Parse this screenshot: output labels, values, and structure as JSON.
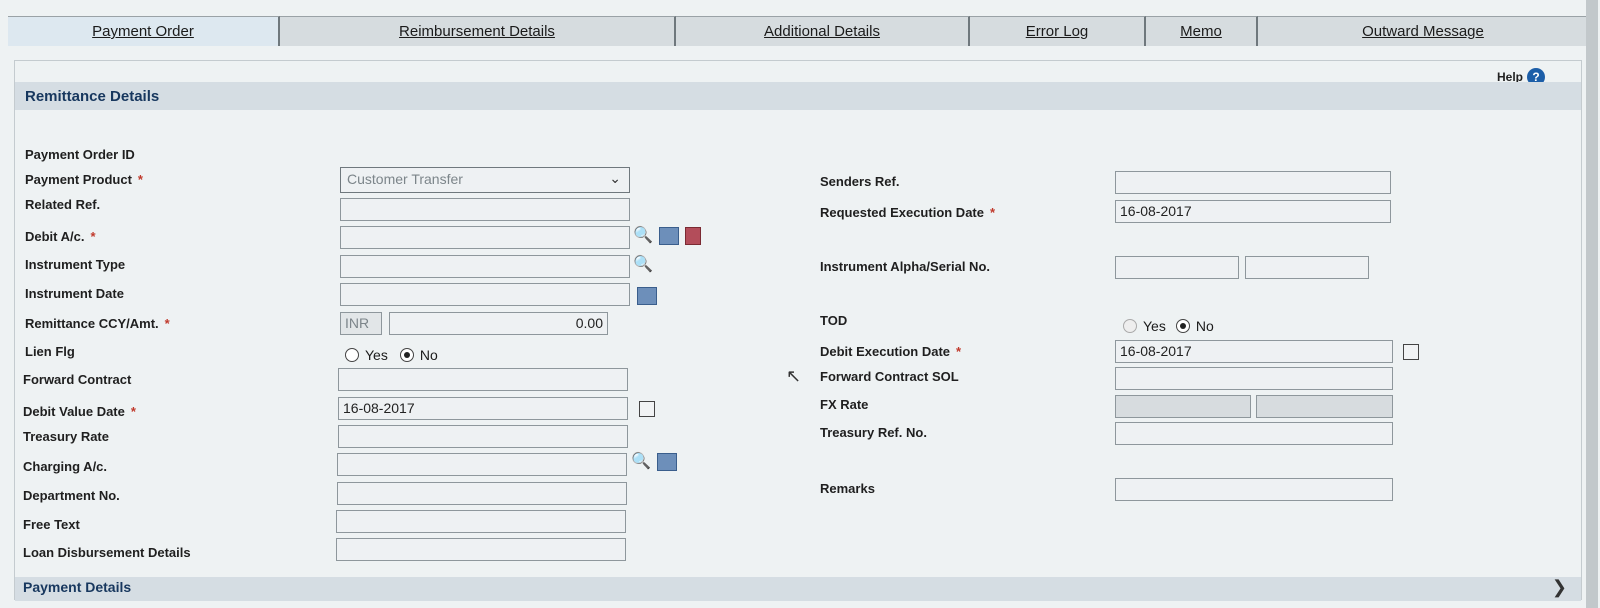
{
  "tabs": [
    {
      "label": "Payment Order",
      "active": true
    },
    {
      "label": "Reimbursement Details"
    },
    {
      "label": "Additional Details"
    },
    {
      "label": "Error Log"
    },
    {
      "label": "Memo"
    },
    {
      "label": "Outward Message"
    }
  ],
  "help": {
    "label": "Help",
    "icon": "?"
  },
  "section": {
    "title": "Remittance Details"
  },
  "bottom_section": {
    "title": "Payment Details"
  },
  "required_mark": "*",
  "left": {
    "payment_order_id": {
      "label": "Payment Order ID"
    },
    "payment_product": {
      "label": "Payment Product",
      "value": "Customer Transfer"
    },
    "related_ref": {
      "label": "Related Ref."
    },
    "debit_ac": {
      "label": "Debit A/c."
    },
    "instrument_type": {
      "label": "Instrument Type"
    },
    "instrument_date": {
      "label": "Instrument Date"
    },
    "remittance_ccy_amt": {
      "label": "Remittance CCY/Amt.",
      "ccy": "INR",
      "amount": "0.00"
    },
    "lien_flg": {
      "label": "Lien Flg",
      "yes": "Yes",
      "no": "No",
      "selected": "No"
    },
    "forward_contract": {
      "label": "Forward Contract"
    },
    "debit_value_date": {
      "label": "Debit Value Date",
      "value": "16-08-2017"
    },
    "treasury_rate": {
      "label": "Treasury Rate"
    },
    "charging_ac": {
      "label": "Charging A/c."
    },
    "department_no": {
      "label": "Department No."
    },
    "free_text": {
      "label": "Free Text"
    },
    "loan_disbursement": {
      "label": "Loan Disbursement Details"
    }
  },
  "right": {
    "senders_ref": {
      "label": "Senders Ref."
    },
    "requested_execution_date": {
      "label": "Requested Execution Date",
      "value": "16-08-2017"
    },
    "instrument_alpha_serial": {
      "label": "Instrument Alpha/Serial No."
    },
    "tod": {
      "label": "TOD",
      "yes": "Yes",
      "no": "No",
      "selected": "No"
    },
    "debit_execution_date": {
      "label": "Debit Execution Date",
      "value": "16-08-2017"
    },
    "forward_contract_sol": {
      "label": "Forward Contract SOL"
    },
    "fx_rate": {
      "label": "FX Rate"
    },
    "treasury_ref_no": {
      "label": "Treasury Ref. No."
    },
    "remarks": {
      "label": "Remarks"
    }
  }
}
